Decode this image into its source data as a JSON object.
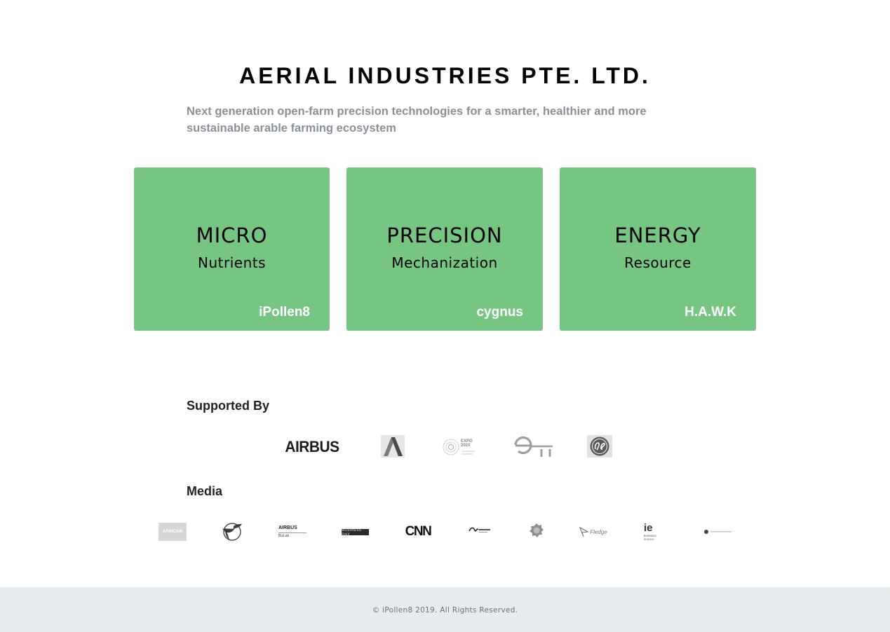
{
  "header": {
    "title": "AERIAL INDUSTRIES PTE. LTD.",
    "subtitle": "Next generation open-farm precision technologies for a smarter, healthier and more sustainable arable farming ecosystem"
  },
  "cards": [
    {
      "heading": "MICRO",
      "sub": "Nutrients",
      "brand": "iPollen8"
    },
    {
      "heading": "PRECISION",
      "sub": "Mechanization",
      "brand": "cygnus"
    },
    {
      "heading": "ENERGY",
      "sub": "Resource",
      "brand": "H.A.W.K"
    }
  ],
  "supported": {
    "heading": "Supported By",
    "logos": {
      "airbus": "AIRBUS",
      "expo_lines": [
        "EXPO",
        "2020"
      ]
    }
  },
  "media": {
    "heading": "Media",
    "logos": {
      "african": "AFRICAN",
      "airbus_bizlab_top": "AIRBUS",
      "airbus_bizlab_sub": "BizLab",
      "businessday": "BUSINESS DAY",
      "cnn": "CNN",
      "ie": "ie",
      "ie_sub": "BUSINESS SCHOOL",
      "fledge": "Fledge"
    }
  },
  "footer": {
    "copyright": "© iPollen8 2019. All Rights Reserved."
  },
  "colors": {
    "card_green": "#77c583",
    "subtitle_gray": "#8a9099",
    "footer_bg": "#e8ebee"
  }
}
